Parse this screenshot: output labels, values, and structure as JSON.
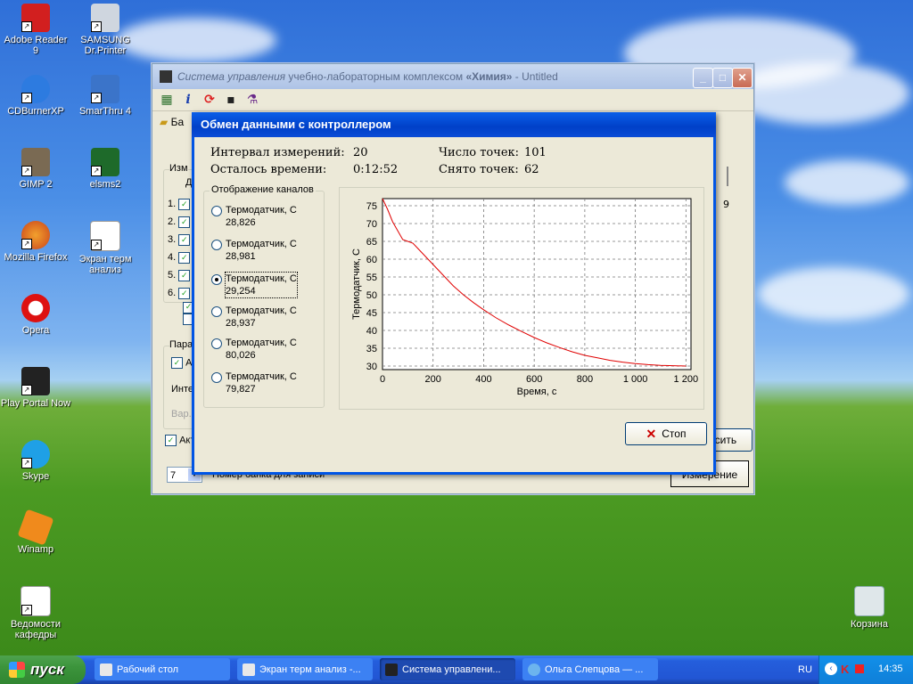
{
  "desktop": {
    "icons": [
      {
        "label": "Adobe Reader 9"
      },
      {
        "label": "SAMSUNG Dr.Printer"
      },
      {
        "label": "CDBurnerXP"
      },
      {
        "label": "SmarThru 4"
      },
      {
        "label": "GIMP 2"
      },
      {
        "label": "elsms2"
      },
      {
        "label": "Mozilla Firefox"
      },
      {
        "label": "Экран терм анализ"
      },
      {
        "label": "Opera"
      },
      {
        "label": "Play Portal Now"
      },
      {
        "label": "Skype"
      },
      {
        "label": "Winamp"
      },
      {
        "label": "Ведомости кафедры"
      },
      {
        "label": "Корзина"
      }
    ]
  },
  "main_window": {
    "title_italic": "Система управления",
    "title_rest": " учебно-лабораторным комплексом ",
    "title_bold": "«Химия»",
    "title_suffix": " - Untitled",
    "tab_label": "Ба",
    "group_label": "Изм",
    "column_d": "Д",
    "rows": [
      "1.",
      "2.",
      "3.",
      "4.",
      "5.",
      "6."
    ],
    "params_label": "Пара",
    "param_a": "А",
    "param_int": "Инте",
    "param_var": "Вар.",
    "auto_label": "Акт",
    "slider_value": "9",
    "button_right": "осить",
    "bank_value": "7",
    "bank_label": "Номер банка для записи",
    "measure_button": "Измерение"
  },
  "dialog": {
    "title": "Обмен данными с контроллером",
    "interval_label": "Интервал измерений:",
    "interval_value": "20",
    "remaining_label": "Осталось времени:",
    "remaining_value": "0:12:52",
    "points_label": "Число точек:",
    "points_value": "101",
    "taken_label": "Снято точек:",
    "taken_value": "62",
    "channels_legend": "Отображение каналов",
    "channels": [
      {
        "name": "Термодатчик, С",
        "value": "28,826",
        "selected": false
      },
      {
        "name": "Термодатчик, С",
        "value": "28,981",
        "selected": false
      },
      {
        "name": "Термодатчик, С",
        "value": "29,254",
        "selected": true
      },
      {
        "name": "Термодатчик, С",
        "value": "28,937",
        "selected": false
      },
      {
        "name": "Термодатчик, С",
        "value": "80,026",
        "selected": false
      },
      {
        "name": "Термодатчик, С",
        "value": "79,827",
        "selected": false
      }
    ],
    "stop_label": "Стоп"
  },
  "chart_data": {
    "type": "line",
    "xlabel": "Время, с",
    "ylabel": "Термодатчик, С",
    "xlim": [
      0,
      1220
    ],
    "ylim": [
      29,
      77
    ],
    "xticks": [
      0,
      200,
      400,
      600,
      800,
      1000,
      1200
    ],
    "xtick_labels": [
      "0",
      "200",
      "400",
      "600",
      "800",
      "1 000",
      "1 200"
    ],
    "yticks": [
      30,
      35,
      40,
      45,
      50,
      55,
      60,
      65,
      70,
      75
    ],
    "grid": true,
    "series": [
      {
        "color": "#e00000",
        "x": [
          0,
          20,
          40,
          60,
          80,
          100,
          120,
          140,
          160,
          180,
          200,
          240,
          280,
          320,
          360,
          400,
          450,
          500,
          550,
          600,
          650,
          700,
          750,
          800,
          850,
          900,
          950,
          1000,
          1050,
          1100,
          1150,
          1200
        ],
        "y": [
          77,
          74,
          70.5,
          68,
          65.5,
          65,
          64.5,
          63,
          61.5,
          60,
          58.5,
          55.5,
          52.5,
          50,
          47.8,
          45.8,
          43.5,
          41.5,
          39.7,
          38,
          36.5,
          35.2,
          34,
          33,
          32.3,
          31.6,
          31.1,
          30.7,
          30.4,
          30.2,
          30.1,
          30
        ]
      }
    ]
  },
  "taskbar": {
    "start_label": "пуск",
    "tasks": [
      {
        "label": "Рабочий стол"
      },
      {
        "label": "Экран терм анализ -..."
      },
      {
        "label": "Система управлени..."
      },
      {
        "label": "Ольга Слепцова — ..."
      }
    ],
    "lang": "RU",
    "clock": "14:35"
  }
}
